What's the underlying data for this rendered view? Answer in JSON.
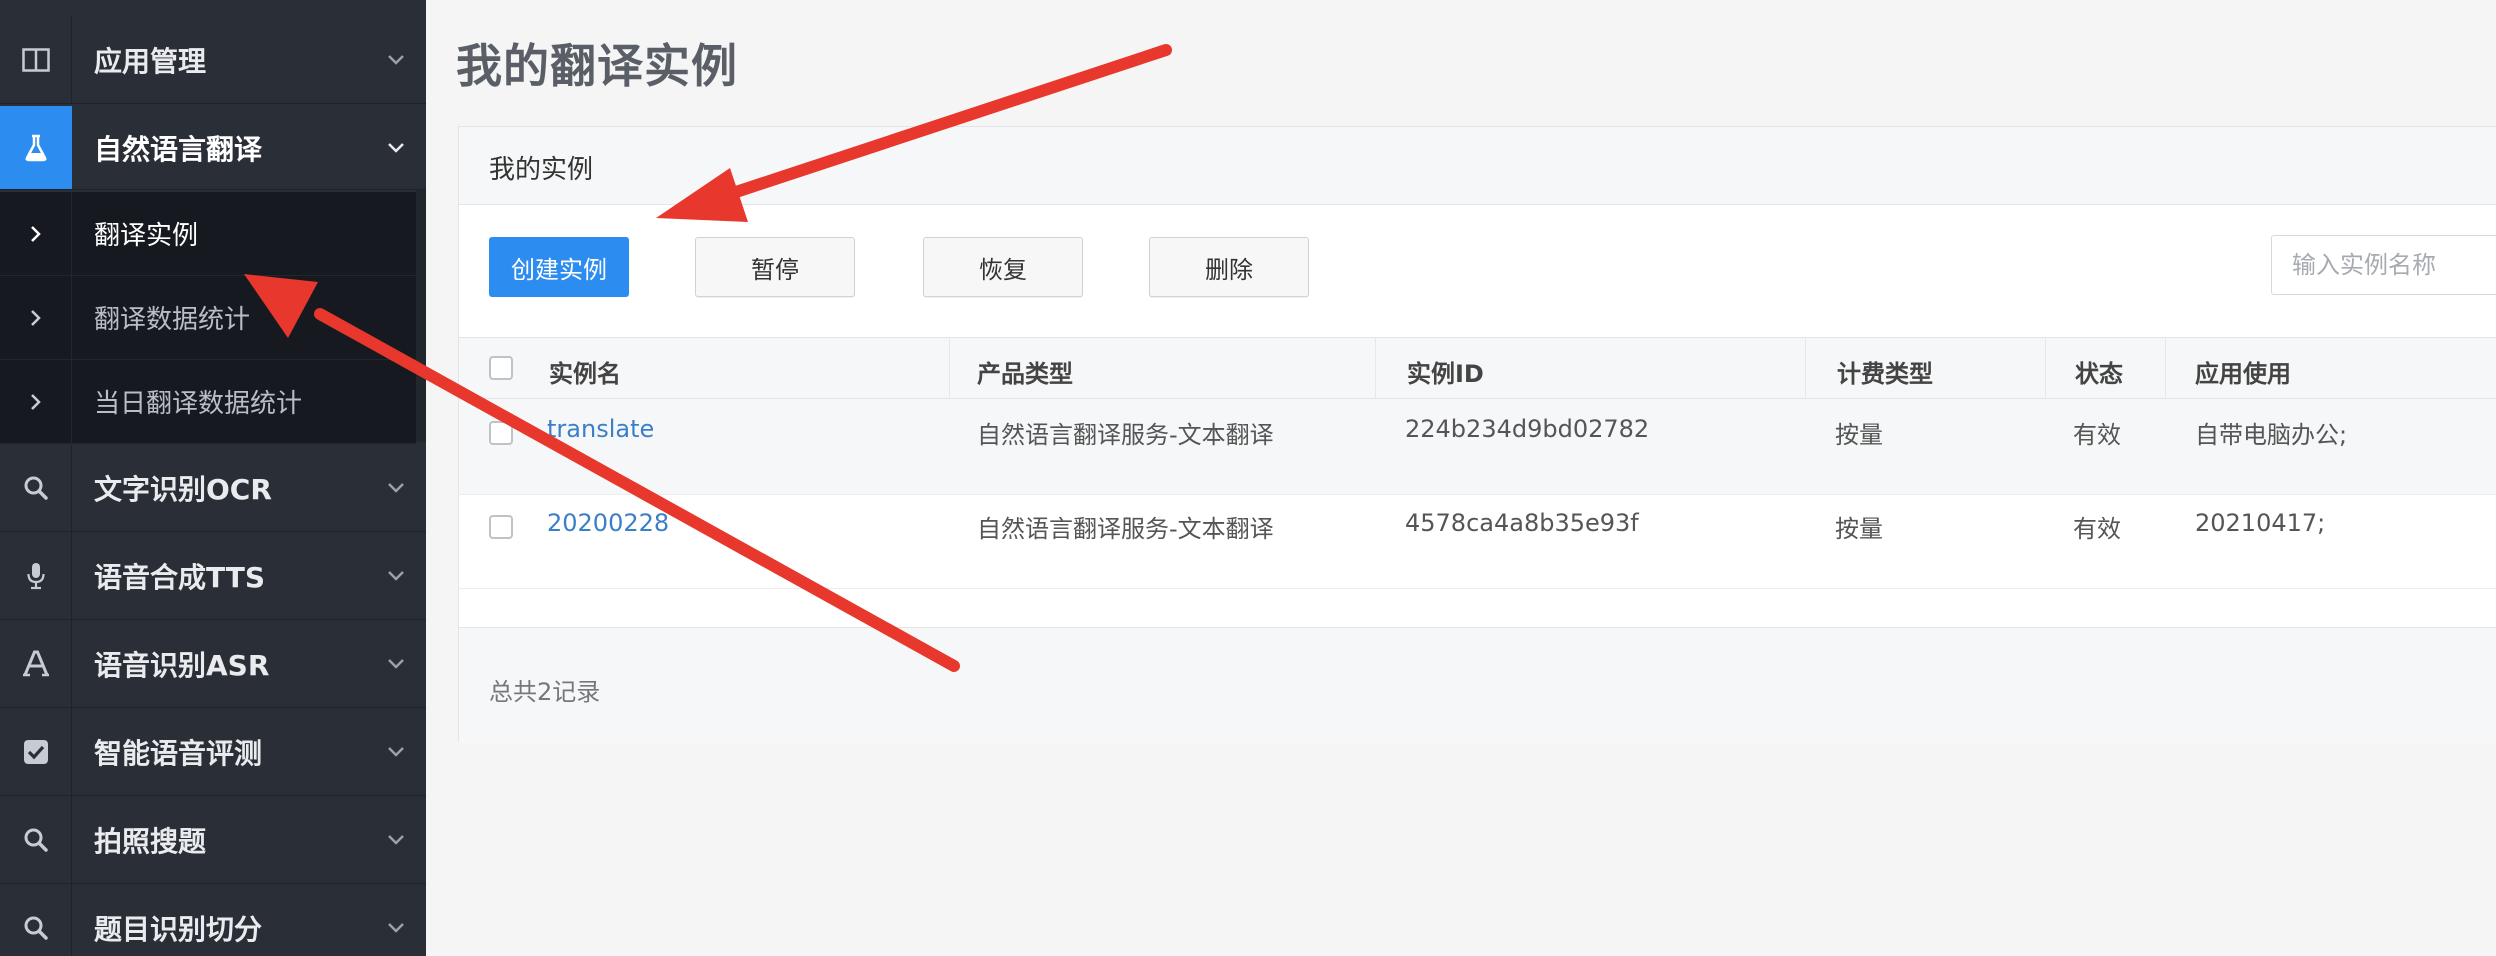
{
  "sidebar": {
    "items": [
      {
        "label": "应用管理",
        "icon": "columns-icon"
      },
      {
        "label": "自然语言翻译",
        "icon": "flask-icon"
      },
      {
        "label": "文字识别OCR",
        "icon": "search-icon"
      },
      {
        "label": "语音合成TTS",
        "icon": "microphone-icon"
      },
      {
        "label": "语音识别ASR",
        "icon": "font-a-icon"
      },
      {
        "label": "智能语音评测",
        "icon": "checkbox-icon"
      },
      {
        "label": "拍照搜题",
        "icon": "search-icon"
      },
      {
        "label": "题目识别切分",
        "icon": "search-icon"
      }
    ],
    "submenu": [
      {
        "label": "翻译实例"
      },
      {
        "label": "翻译数据统计"
      },
      {
        "label": "当日翻译数据统计"
      }
    ]
  },
  "main": {
    "title": "我的翻译实例",
    "panel": {
      "title": "我的实例",
      "buttons": {
        "create": "创建实例",
        "pause": "暂停",
        "resume": "恢复",
        "delete": "删除"
      },
      "search_placeholder": "输入实例名称",
      "table": {
        "headers": [
          "实例名",
          "产品类型",
          "实例ID",
          "计费类型",
          "状态",
          "应用使用"
        ],
        "rows": [
          [
            "translate",
            "自然语言翻译服务-文本翻译",
            "224b234d9bd02782",
            "按量",
            "有效",
            "自带电脑办公;"
          ],
          [
            "20200228",
            "自然语言翻译服务-文本翻译",
            "4578ca4a8b35e93f",
            "按量",
            "有效",
            "20210417;"
          ]
        ]
      },
      "footer": "总共2记录"
    }
  },
  "colors": {
    "sidebar_bg": "#2a2e36",
    "accent": "#2d8cf0",
    "arrow": "#e8372c",
    "link": "#3a7fc8"
  }
}
